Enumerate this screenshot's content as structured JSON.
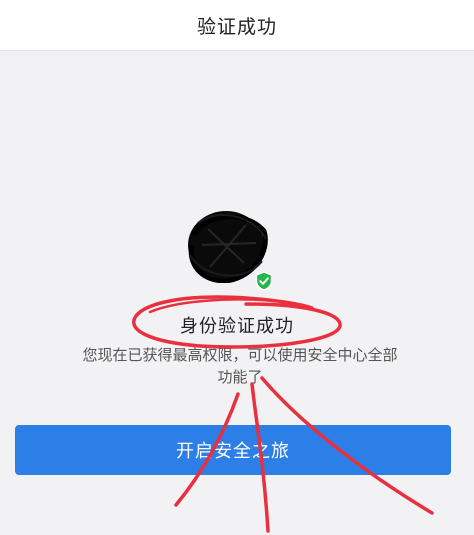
{
  "header": {
    "title": "验证成功"
  },
  "profile": {
    "avatar_icon": "redacted-avatar",
    "badge_icon": "check-shield-icon",
    "badge_color": "#25b64d"
  },
  "status": {
    "title": "身份验证成功",
    "description": "您现在已获得最高权限，可以使用安全中心全部功能了"
  },
  "action": {
    "button_label": "开启安全之旅",
    "button_color": "#2b7fe6"
  },
  "annotation": {
    "pen_color": "#e8303f"
  }
}
